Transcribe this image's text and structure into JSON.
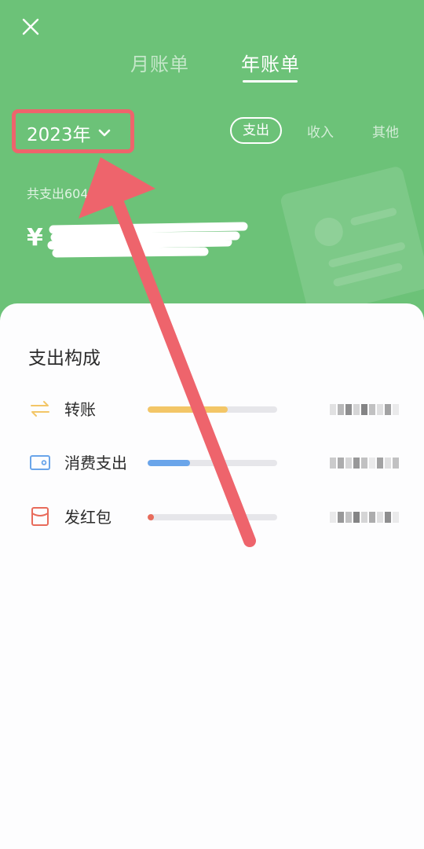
{
  "header": {
    "tabs": [
      {
        "label": "月账单",
        "active": false
      },
      {
        "label": "年账单",
        "active": true
      }
    ],
    "year_label": "2023年",
    "filters": [
      {
        "label": "支出",
        "active": true
      },
      {
        "label": "收入",
        "active": false
      },
      {
        "label": "其他",
        "active": false
      }
    ],
    "total_text": "共支出604",
    "currency": "¥"
  },
  "composition": {
    "title": "支出构成",
    "items": [
      {
        "label": "转账",
        "icon": "transfer-icon",
        "fraction": 0.62,
        "color": "#f3c667"
      },
      {
        "label": "消费支出",
        "icon": "wallet-icon",
        "fraction": 0.33,
        "color": "#6aa5ea"
      },
      {
        "label": "发红包",
        "icon": "red-packet-icon",
        "fraction": 0.05,
        "color": "#e86b5b"
      }
    ]
  },
  "colors": {
    "header_green": "#6cc278",
    "highlight_red": "#ee646c"
  }
}
